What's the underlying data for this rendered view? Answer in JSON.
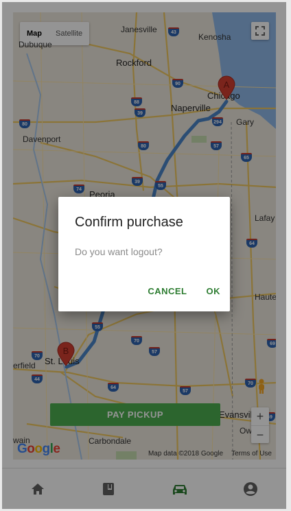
{
  "map": {
    "type_tabs": [
      "Map",
      "Satellite"
    ],
    "active_tab": "Map",
    "cities": [
      {
        "name": "Janesville",
        "big": false
      },
      {
        "name": "Kenosha",
        "big": false
      },
      {
        "name": "Dubuque",
        "big": false
      },
      {
        "name": "Rockford",
        "big": true
      },
      {
        "name": "Chicago",
        "big": true
      },
      {
        "name": "Naperville",
        "big": true
      },
      {
        "name": "Davenport",
        "big": false
      },
      {
        "name": "Gary",
        "big": false
      },
      {
        "name": "Peoria",
        "big": true
      },
      {
        "name": "Lafay",
        "big": false
      },
      {
        "name": "Haute",
        "big": false
      },
      {
        "name": "St. Louis",
        "big": true
      },
      {
        "name": "erfield",
        "big": false
      },
      {
        "name": "Evansville",
        "big": true
      },
      {
        "name": "Carbondale",
        "big": false
      },
      {
        "name": "wain",
        "big": false
      },
      {
        "name": "Owe",
        "big": false
      }
    ],
    "shields": [
      "43",
      "90",
      "88",
      "39",
      "294",
      "80",
      "57",
      "80",
      "65",
      "74",
      "39",
      "55",
      "55",
      "70",
      "57",
      "70",
      "64",
      "57",
      "69",
      "44",
      "64",
      "69",
      "70"
    ],
    "markers": {
      "start": "A",
      "end": "B"
    },
    "zoom": {
      "in": "+",
      "out": "−"
    },
    "logo": "Google",
    "attribution": [
      "Map data ©2018 Google",
      "Terms of Use"
    ]
  },
  "pay_button": "PAY PICKUP",
  "dialog": {
    "title": "Confirm purchase",
    "message": "Do you want logout?",
    "cancel": "CANCEL",
    "ok": "OK"
  },
  "nav": [
    {
      "icon": "home-icon",
      "active": false
    },
    {
      "icon": "book-icon",
      "active": false
    },
    {
      "icon": "car-icon",
      "active": true
    },
    {
      "icon": "account-icon",
      "active": false
    }
  ],
  "colors": {
    "accent_green": "#2e7d32",
    "button_green": "#4caf50",
    "route_blue": "#4a86c8",
    "marker_red": "#d23f31"
  }
}
